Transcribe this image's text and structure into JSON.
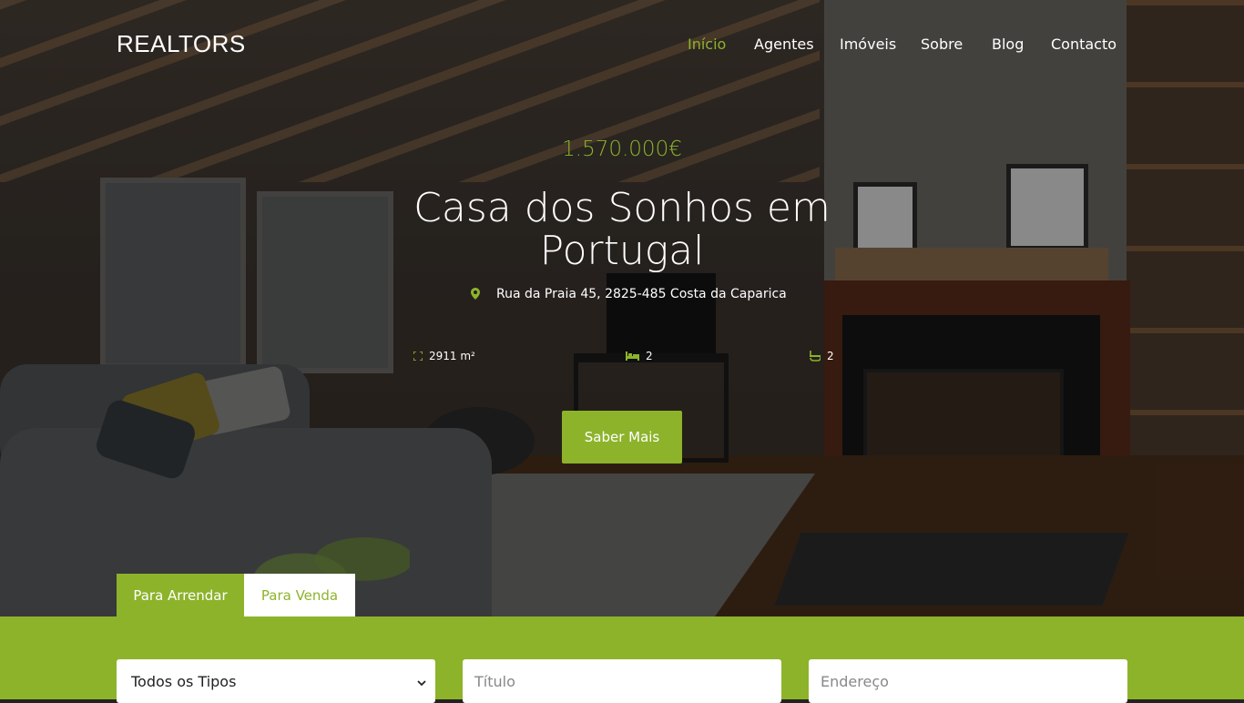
{
  "header": {
    "logo": "REALTORS",
    "nav": [
      {
        "label": "Início",
        "active": true
      },
      {
        "label": "Agentes",
        "active": false
      },
      {
        "label": "Imóveis",
        "active": false
      },
      {
        "label": "Sobre",
        "active": false
      },
      {
        "label": "Blog",
        "active": false
      },
      {
        "label": "Contacto",
        "active": false
      }
    ]
  },
  "hero": {
    "price": "1.570.000€",
    "title": "Casa dos Sonhos em Portugal",
    "address": "Rua da Praia 45, 2825-485 Costa da Caparica",
    "features": {
      "area": "2911 m²",
      "bedrooms": "2",
      "bathrooms": "2"
    },
    "cta_label": "Saber Mais"
  },
  "tabs": [
    {
      "label": "Para Arrendar",
      "active": true
    },
    {
      "label": "Para Venda",
      "active": false
    }
  ],
  "search": {
    "type_selected": "Todos os Tipos",
    "title_placeholder": "Título",
    "address_placeholder": "Endereço"
  },
  "colors": {
    "accent": "#8db32b",
    "text_light": "#ffffff"
  }
}
